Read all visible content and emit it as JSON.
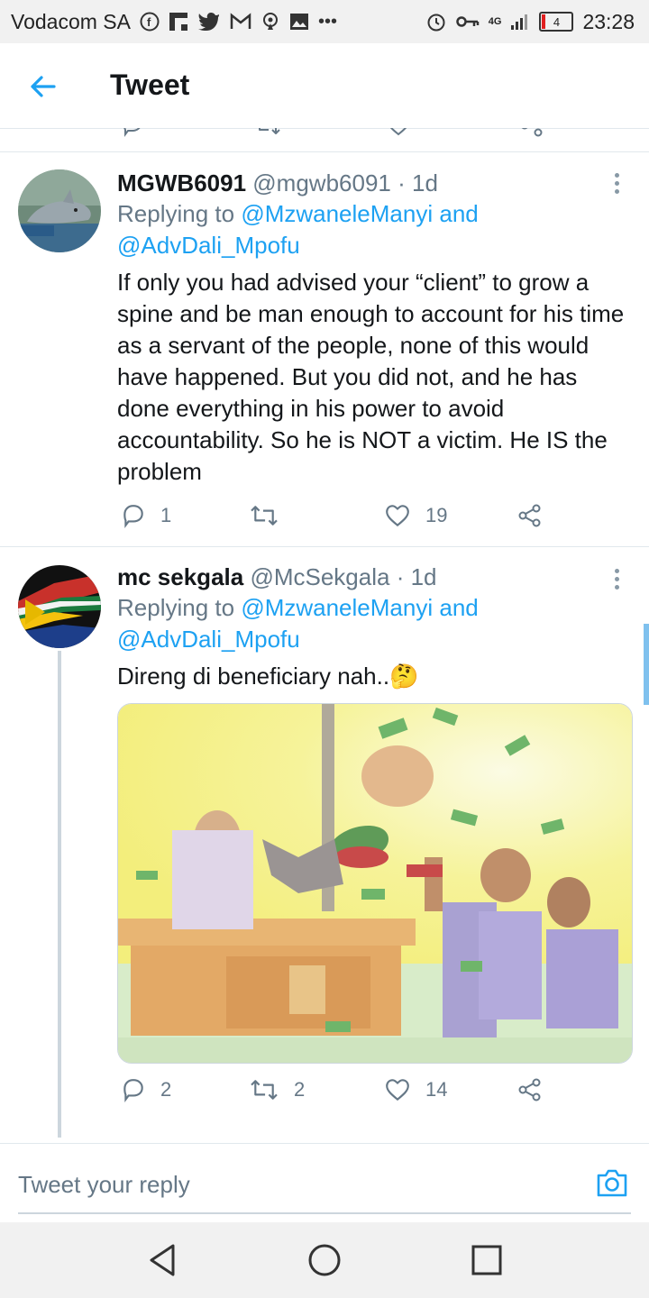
{
  "status_bar": {
    "carrier": "Vodacom SA",
    "network": "4G",
    "battery": "4",
    "time": "23:28",
    "icons": [
      "facebook-icon",
      "flipboard-icon",
      "twitter-icon",
      "gmail-icon",
      "podcast-icon",
      "gallery-icon",
      "more-dots-icon",
      "alarm-icon",
      "key-icon",
      "signal-icon",
      "battery-icon"
    ]
  },
  "header": {
    "title": "Tweet"
  },
  "tweets": [
    {
      "name": "MGWB6091",
      "handle": "@mgwb6091",
      "time": "· 1d",
      "replying_prefix": "Replying to",
      "mention1": "@MzwaneleManyi",
      "and": "and",
      "mention2": "@AdvDali_Mpofu",
      "text": "If only you had advised your “client” to grow a spine and be man enough to account for his time as a servant of the people, none of this would have happened. But you did not, and he has done everything in his power to avoid accountability. So he is NOT a victim. He IS the problem",
      "replies": "1",
      "retweets": "",
      "likes": "19"
    },
    {
      "name": "mc sekgala",
      "handle": "@McSekgala",
      "time": "· 1d",
      "replying_prefix": "Replying to",
      "mention1": "@MzwaneleManyi",
      "and": "and",
      "mention2": "@AdvDali_Mpofu",
      "text": "Direng di beneficiary nah..🤔",
      "replies": "2",
      "retweets": "2",
      "likes": "14"
    }
  ],
  "reply_bar": {
    "placeholder": "Tweet your reply"
  },
  "colors": {
    "accent": "#1da1f2",
    "secondary_text": "#657786",
    "divider": "#e1e8ed"
  }
}
